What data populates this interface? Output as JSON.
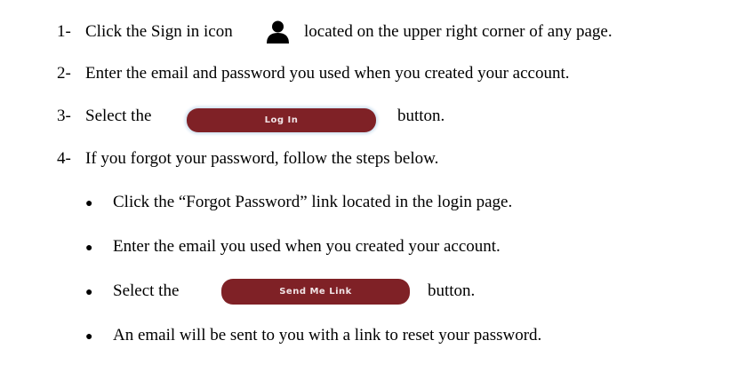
{
  "steps": [
    {
      "num": "1-",
      "before": "Click the Sign in icon",
      "after": "located on the upper right corner of any page.",
      "icon": "user-icon"
    },
    {
      "num": "2-",
      "text": "Enter the email and password you used when you created your account."
    },
    {
      "num": "3-",
      "before": "Select the",
      "button": "Log In",
      "after": "button."
    },
    {
      "num": "4-",
      "text": "If you forgot your password, follow the steps below."
    }
  ],
  "substeps": [
    {
      "text": "Click the “Forgot Password” link located in the login page."
    },
    {
      "text": "Enter the email you used when you created your account."
    },
    {
      "before": "Select the",
      "button": "Send Me Link",
      "after": "button."
    },
    {
      "text": "An email will be sent to you with a link to reset your password."
    }
  ],
  "colors": {
    "button": "#7f2126"
  }
}
